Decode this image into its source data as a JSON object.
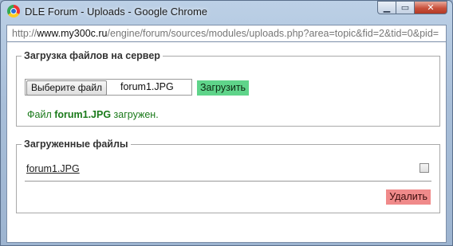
{
  "window": {
    "title": "DLE Forum - Uploads - Google Chrome",
    "controls": {
      "minimize": "▁",
      "maximize": "▭",
      "close": "✕"
    }
  },
  "address_bar": {
    "prefix": "http://",
    "host": "www.my300c.ru",
    "path": "/engine/forum/sources/modules/uploads.php?area=topic&fid=2&tid=0&pid="
  },
  "upload_section": {
    "legend": "Загрузка файлов на сервер",
    "choose_button": "Выберите файл",
    "chosen_file": "forum1.JPG",
    "upload_button": "Загрузить",
    "status": {
      "prefix": "Файл ",
      "filename": "forum1.JPG",
      "suffix": " загружен."
    }
  },
  "files_section": {
    "legend": "Загруженные файлы",
    "files": [
      {
        "name": "forum1.JPG",
        "checked": false
      }
    ],
    "delete_button": "Удалить"
  },
  "colors": {
    "upload_button": "#5fd48a",
    "delete_button": "#f08a8a",
    "status_text": "#1a7a1a"
  },
  "icons": {
    "app": "chrome-icon"
  }
}
